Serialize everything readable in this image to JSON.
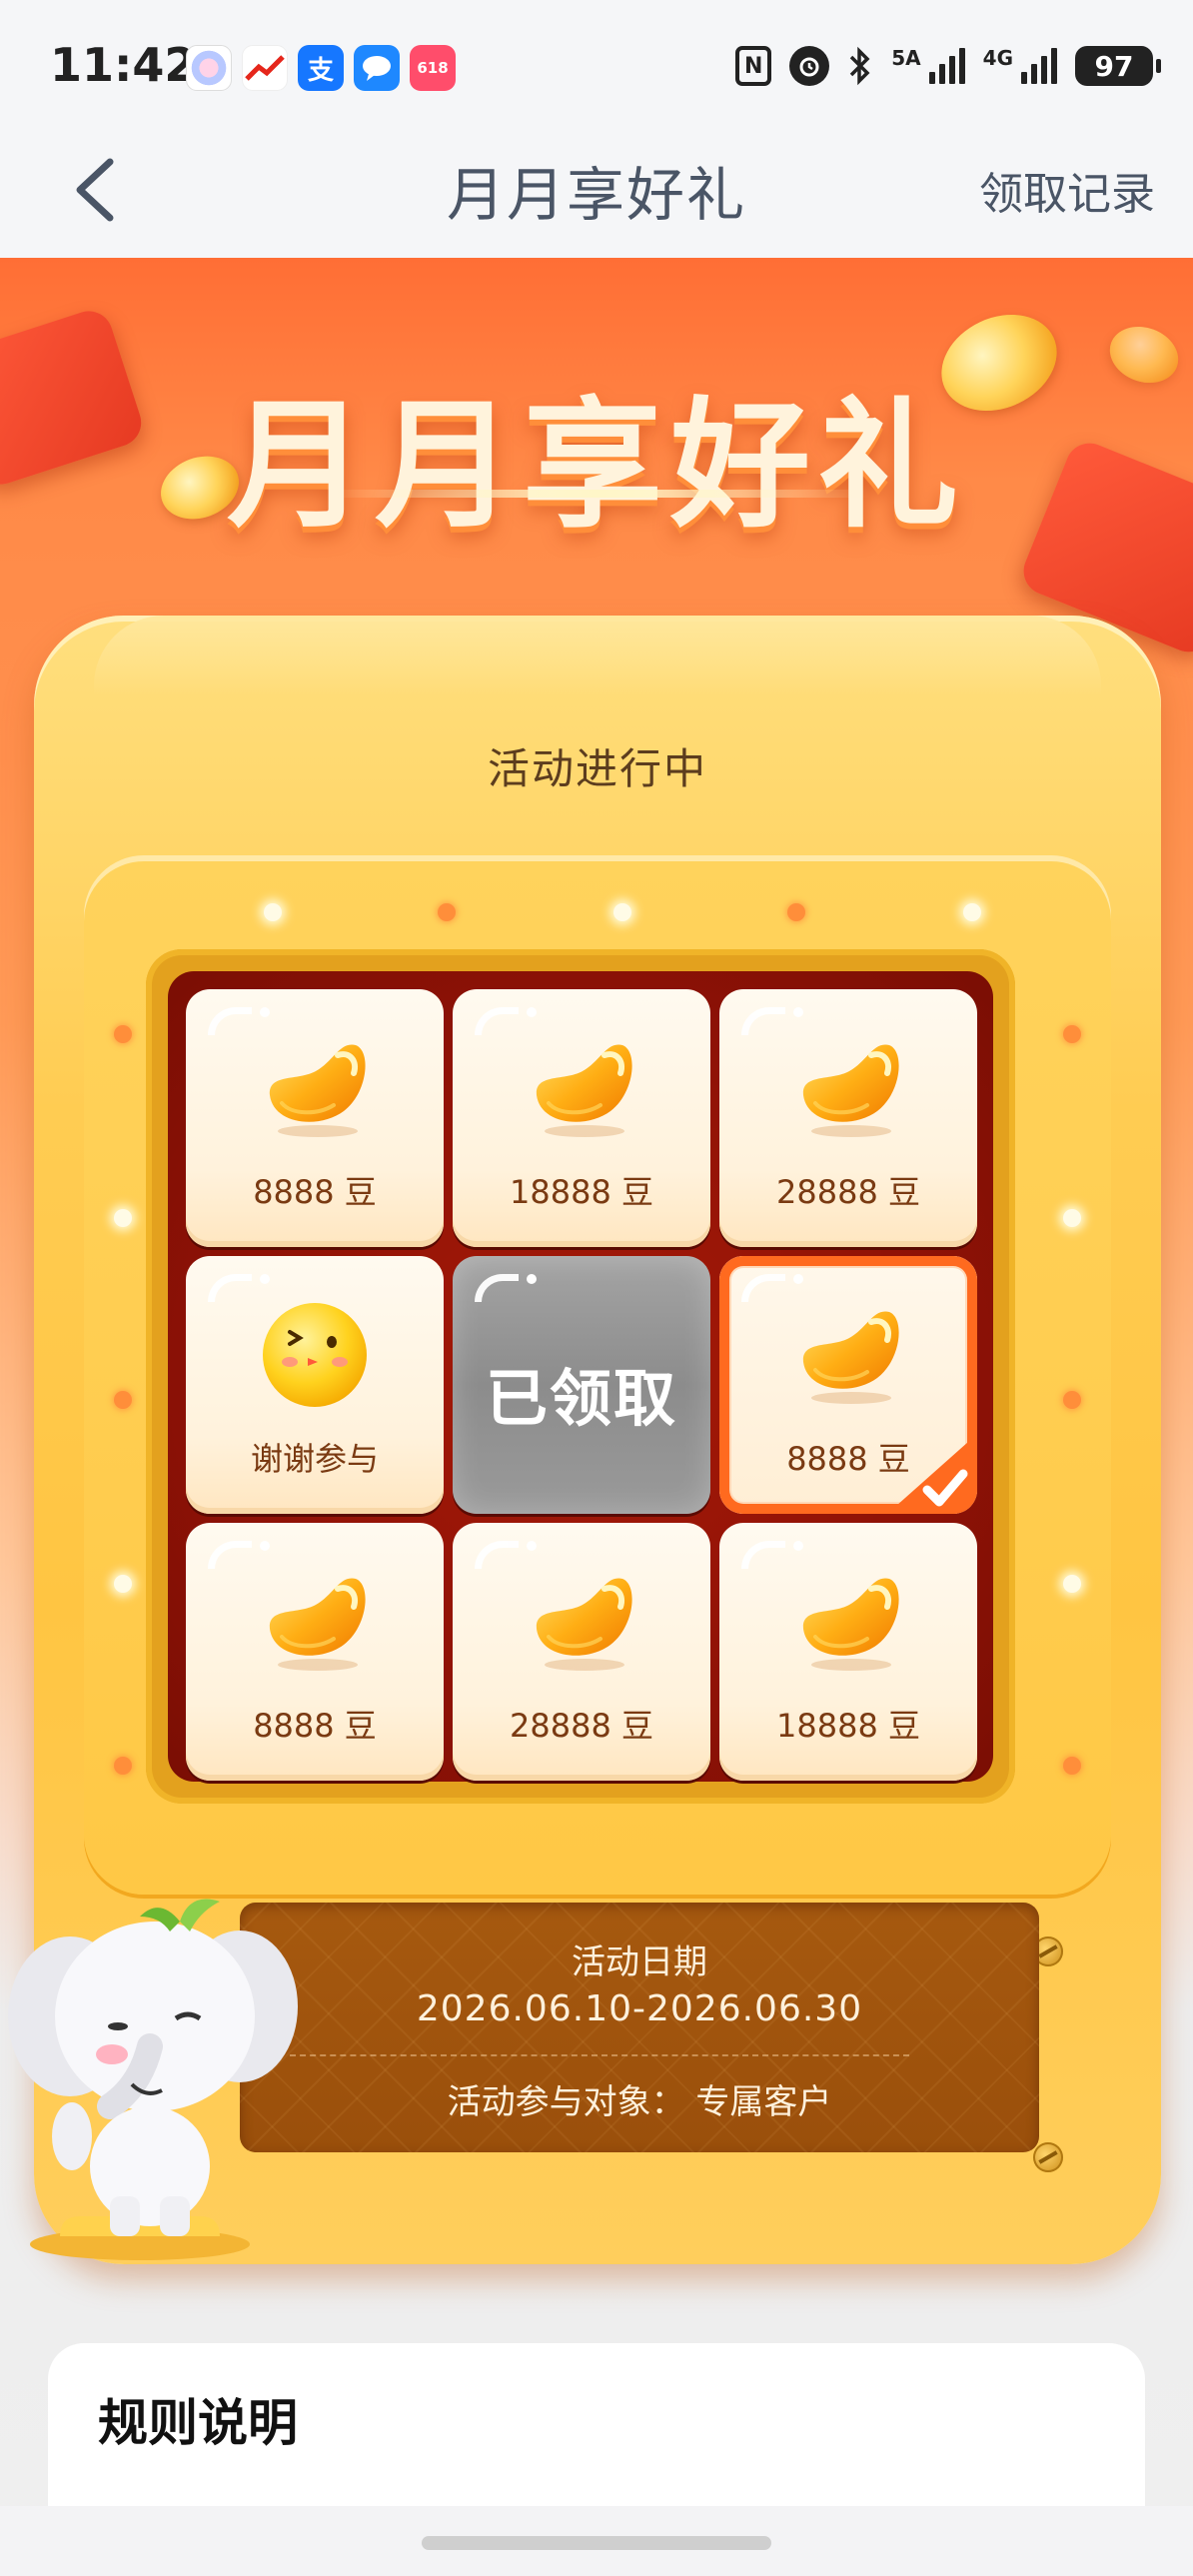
{
  "status_bar": {
    "time": "11:42",
    "battery": "97",
    "signal_1_label": "5A",
    "signal_2_label": "4G",
    "icons": [
      "nfc-icon",
      "alarm-icon",
      "bluetooth-icon",
      "signal-icon",
      "battery-icon"
    ],
    "app_icons": [
      "photos-app-icon",
      "stock-app-icon",
      "alipay-app-icon",
      "message-app-icon",
      "shopping-app-icon"
    ],
    "alipay_glyph": "支",
    "shopping_badge": "618"
  },
  "nav": {
    "title": "月月享好礼",
    "right_link": "领取记录"
  },
  "hero": {
    "title": "月月享好礼"
  },
  "activity": {
    "status": "活动进行中",
    "date_label": "活动日期",
    "date_range": "2026.06.10-2026.06.30",
    "audience": "活动参与对象：  专属客户"
  },
  "prizes": [
    {
      "type": "bean",
      "label": "8888 豆"
    },
    {
      "type": "bean",
      "label": "18888 豆"
    },
    {
      "type": "bean",
      "label": "28888 豆"
    },
    {
      "type": "smiley",
      "label": "谢谢参与"
    },
    {
      "type": "claimed",
      "label": "已领取"
    },
    {
      "type": "bean",
      "label": "8888 豆",
      "selected": true
    },
    {
      "type": "bean",
      "label": "8888 豆"
    },
    {
      "type": "bean",
      "label": "28888 豆"
    },
    {
      "type": "bean",
      "label": "18888 豆"
    }
  ],
  "rules": {
    "title": "规则说明"
  },
  "colors": {
    "accent_orange": "#ff6a1f",
    "hero_top": "#ff6e35",
    "gold": "#ffc845",
    "board_red": "#8f1206",
    "panel_brown": "#9a4f0b"
  }
}
